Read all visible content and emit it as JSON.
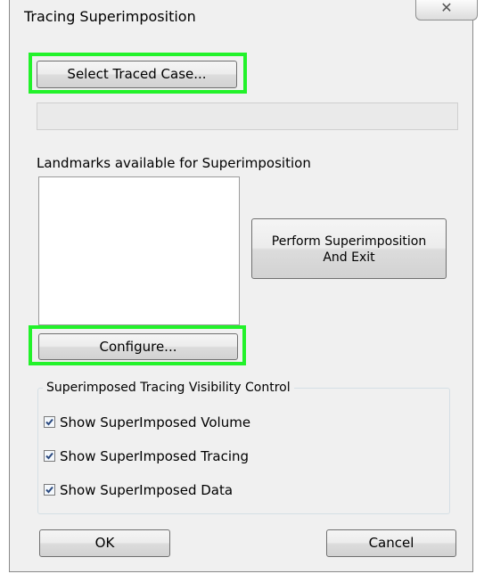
{
  "window": {
    "title": "Tracing Superimposition",
    "close_glyph": "✕"
  },
  "select_traced_case_label": "Select Traced Case...",
  "traced_case_value": "",
  "landmarks": {
    "label": "Landmarks available for Superimposition",
    "items": []
  },
  "perform_button": {
    "line1": "Perform Superimposition",
    "line2": "And Exit"
  },
  "configure_label": "Configure...",
  "visibility": {
    "title": "Superimposed Tracing Visibility Control",
    "options": [
      {
        "label": "Show SuperImposed Volume",
        "checked": true
      },
      {
        "label": "Show SuperImposed Tracing",
        "checked": true
      },
      {
        "label": "Show SuperImposed Data",
        "checked": true
      }
    ]
  },
  "footer": {
    "ok_label": "OK",
    "cancel_label": "Cancel"
  },
  "colors": {
    "highlight": "#22f22a",
    "dialog_bg": "#f0f0f0",
    "check_mark": "#2b4a80"
  }
}
